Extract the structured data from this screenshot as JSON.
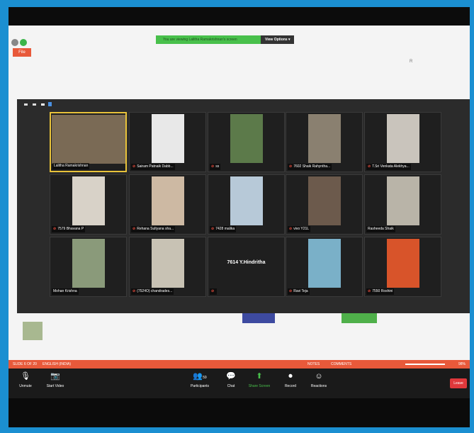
{
  "sharing_banner": {
    "message": "You are viewing Lalitha Ramakrishnan's screen",
    "view_options": "View Options ▾"
  },
  "slide": {
    "file_tab": "File",
    "corner_mark": "R"
  },
  "gallery": {
    "tiles": [
      {
        "name": "Lalitha Ramakrishnan",
        "muted": false,
        "active": true,
        "video": "#7a6a55"
      },
      {
        "name": "Sairam Patnaik Dabb...",
        "muted": true,
        "active": false,
        "video": "#e8e8e8"
      },
      {
        "name": "ss",
        "muted": true,
        "active": false,
        "video": "#5c7a4a"
      },
      {
        "name": "7602 Shaik Rahyntha...",
        "muted": true,
        "active": false,
        "video": "#8a8070"
      },
      {
        "name": "T.Sri Venkata Alekhya...",
        "muted": true,
        "active": false,
        "video": "#c9c4bc"
      },
      {
        "name": "7579 Bhavana P",
        "muted": true,
        "active": false,
        "video": "#d8d2c8"
      },
      {
        "name": "Rehana Sultyana sha...",
        "muted": true,
        "active": false,
        "video": "#cdb9a3"
      },
      {
        "name": "7428 malika",
        "muted": true,
        "active": false,
        "video": "#b7c9d8"
      },
      {
        "name": "vivo Y21L",
        "muted": true,
        "active": false,
        "video": "#6c5a4c"
      },
      {
        "name": "Rasheeda Shaik",
        "muted": false,
        "active": false,
        "video": "#b9b4a8"
      },
      {
        "name": "Mohan Krishna",
        "muted": false,
        "active": false,
        "video": "#8a9a7a"
      },
      {
        "name": "(7524O) chandrades...",
        "muted": true,
        "active": false,
        "video": "#c8c2b4"
      },
      {
        "name": "",
        "muted": true,
        "active": false,
        "video": "",
        "big_name": "7614 Y.Hindritha"
      },
      {
        "name": "Ravi Teja",
        "muted": true,
        "active": false,
        "video": "#7ab0c8"
      },
      {
        "name": "7550 Roshini",
        "muted": true,
        "active": false,
        "video": "#d8542a"
      }
    ]
  },
  "statusbar": {
    "slide_info": "SLIDE 6 OF 20",
    "language": "ENGLISH (INDIA)",
    "notes": "NOTES",
    "comments": "COMMENTS",
    "zoom": "98%"
  },
  "controls": {
    "unmute": "Unmute",
    "start_video": "Start Video",
    "participants": "Participants",
    "participants_count": "59",
    "chat": "Chat",
    "share_screen": "Share Screen",
    "record": "Record",
    "reactions": "Reactions",
    "leave": "Leave"
  },
  "colors": {
    "frame_border": "#1b8fd1",
    "accent_orange": "#e8593a",
    "share_green": "#48c04b",
    "leave_red": "#e0383b"
  }
}
